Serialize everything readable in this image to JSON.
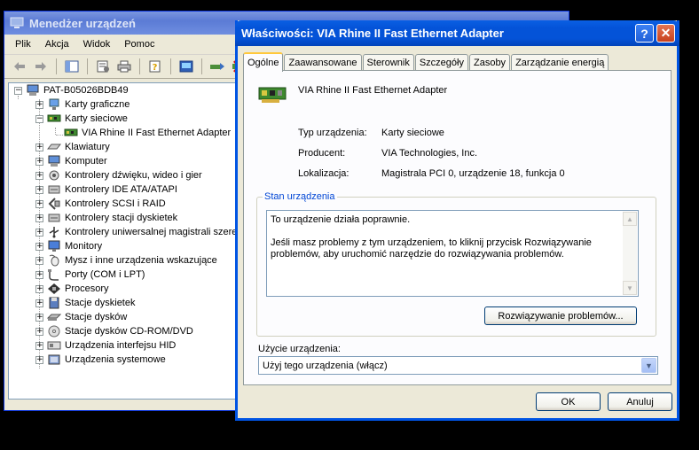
{
  "device_manager": {
    "title": "Menedżer urządzeń",
    "menu": [
      "Plik",
      "Akcja",
      "Widok",
      "Pomoc"
    ],
    "tree": {
      "root": "PAT-B05026BDB49",
      "items": [
        {
          "label": "Karty graficzne",
          "icon": "display-adapter-icon",
          "expanded": false
        },
        {
          "label": "Karty sieciowe",
          "icon": "network-card-icon",
          "expanded": true
        },
        {
          "label": "VIA Rhine II Fast Ethernet Adapter",
          "icon": "network-card-icon",
          "child": true
        },
        {
          "label": "Klawiatury",
          "icon": "keyboard-icon",
          "expanded": false
        },
        {
          "label": "Komputer",
          "icon": "computer-icon",
          "expanded": false
        },
        {
          "label": "Kontrolery dźwięku, wideo i gier",
          "icon": "sound-icon",
          "expanded": false
        },
        {
          "label": "Kontrolery IDE ATA/ATAPI",
          "icon": "ide-controller-icon",
          "expanded": false
        },
        {
          "label": "Kontrolery SCSI i RAID",
          "icon": "scsi-icon",
          "expanded": false
        },
        {
          "label": "Kontrolery stacji dyskietek",
          "icon": "floppy-controller-icon",
          "expanded": false
        },
        {
          "label": "Kontrolery uniwersalnej magistrali szereg",
          "icon": "usb-icon",
          "expanded": false
        },
        {
          "label": "Monitory",
          "icon": "monitor-icon",
          "expanded": false
        },
        {
          "label": "Mysz i inne urządzenia wskazujące",
          "icon": "mouse-icon",
          "expanded": false
        },
        {
          "label": "Porty (COM i LPT)",
          "icon": "port-icon",
          "expanded": false
        },
        {
          "label": "Procesory",
          "icon": "processor-icon",
          "expanded": false
        },
        {
          "label": "Stacje dyskietek",
          "icon": "floppy-icon",
          "expanded": false
        },
        {
          "label": "Stacje dysków",
          "icon": "disk-icon",
          "expanded": false
        },
        {
          "label": "Stacje dysków CD-ROM/DVD",
          "icon": "cdrom-icon",
          "expanded": false
        },
        {
          "label": "Urządzenia interfejsu HID",
          "icon": "hid-icon",
          "expanded": false
        },
        {
          "label": "Urządzenia systemowe",
          "icon": "system-device-icon",
          "expanded": false
        }
      ]
    }
  },
  "dialog": {
    "title": "Właściwości: VIA Rhine II Fast Ethernet Adapter",
    "tabs": [
      "Ogólne",
      "Zaawansowane",
      "Sterownik",
      "Szczegóły",
      "Zasoby",
      "Zarządzanie energią"
    ],
    "active_tab": "Ogólne",
    "device_name": "VIA Rhine II Fast Ethernet Adapter",
    "props": {
      "type_label": "Typ urządzenia:",
      "type_value": "Karty sieciowe",
      "maker_label": "Producent:",
      "maker_value": "VIA Technologies, Inc.",
      "location_label": "Lokalizacja:",
      "location_value": "Magistrala PCI 0, urządzenie 18, funkcja 0"
    },
    "status": {
      "legend": "Stan urządzenia",
      "text": "To urządzenie działa poprawnie.\n\nJeśli masz problemy z tym urządzeniem, to kliknij przycisk Rozwiązywanie\nproblemów, aby uruchomić narzędzie do rozwiązywania problemów.",
      "troubleshoot_button": "Rozwiązywanie problemów..."
    },
    "usage": {
      "label": "Użycie urządzenia:",
      "selected": "Użyj tego urządzenia (włącz)"
    },
    "ok": "OK",
    "cancel": "Anuluj"
  },
  "colors": {
    "xp_blue": "#0054e3",
    "dialog_bg": "#ece9d8",
    "legend_blue": "#0046d5",
    "inactive_title": "#7a96df"
  }
}
